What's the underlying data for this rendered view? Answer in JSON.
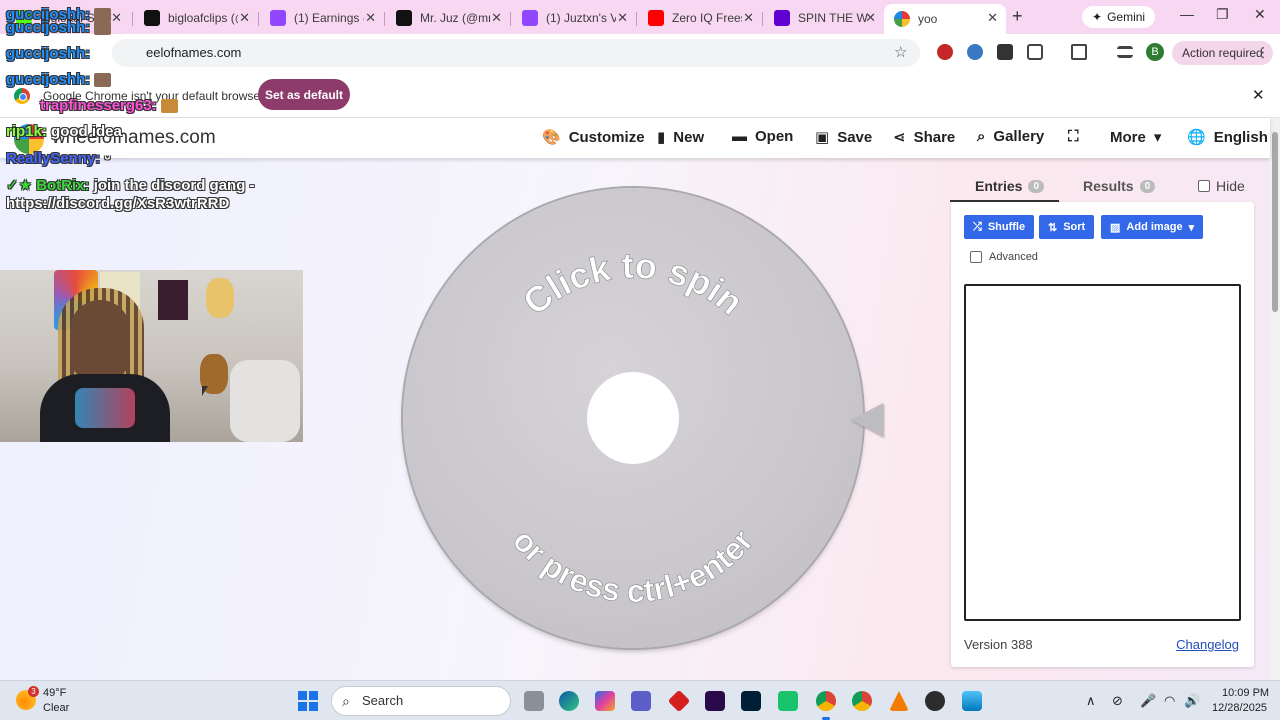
{
  "browser": {
    "tabs": [
      {
        "title": "Bigloaaf Strea",
        "color": "#53fc18"
      },
      {
        "title": "bigloafclips (@",
        "color": "#111111"
      },
      {
        "title": "(1) Earnings -",
        "color": "#9146ff"
      },
      {
        "title": "Mr. Juz (@mr.j",
        "color": "#111111"
      },
      {
        "title": "(1) Juztxn's Vid",
        "color": "#9146ff"
      },
      {
        "title": "Zero IQ Freest",
        "color": "#ff0000"
      },
      {
        "title": "SPIN THE WHE",
        "color": "#6001d2"
      },
      {
        "title": "yoo",
        "color": "#4285f4"
      }
    ],
    "gemini_label": "Gemini",
    "url": "eelofnames.com",
    "action_required": "Action required",
    "profile_initial": "B"
  },
  "infobar": {
    "message": "Google Chrome isn't your default browser",
    "button": "Set as default"
  },
  "site": {
    "name": "wheelofnames.com",
    "nav": [
      {
        "label": "Customize",
        "icon": "palette-icon"
      },
      {
        "label": "New",
        "icon": "file-icon"
      },
      {
        "label": "Open",
        "icon": "folder-icon"
      },
      {
        "label": "Save",
        "icon": "save-icon"
      },
      {
        "label": "Share",
        "icon": "share-icon"
      },
      {
        "label": "Gallery",
        "icon": "search-icon"
      },
      {
        "label": "More",
        "icon": "chevron-down-icon"
      },
      {
        "label": "English",
        "icon": "globe-icon"
      }
    ]
  },
  "wheel": {
    "top_text": "Click to spin",
    "bottom_text": "or press ctrl+enter"
  },
  "panel": {
    "entries_label": "Entries",
    "entries_count": "0",
    "results_label": "Results",
    "results_count": "0",
    "hide_label": "Hide",
    "shuffle_label": "Shuffle",
    "sort_label": "Sort",
    "add_image_label": "Add image",
    "advanced_label": "Advanced",
    "version": "Version 388",
    "changelog": "Changelog",
    "accent_color": "#3369e8"
  },
  "overlay": {
    "chat": [
      {
        "user": "guccijoshh:",
        "message": ""
      },
      {
        "user": "guccijoshh:",
        "message": ""
      },
      {
        "user": "guccijoshh:",
        "message": ""
      },
      {
        "user": "guccijoshh:",
        "message": ""
      },
      {
        "user": "trapfinesserg63:",
        "message": ""
      },
      {
        "user": "rip1k:",
        "message": "good idea"
      },
      {
        "user": "ReallySenny:",
        "message": ""
      },
      {
        "user": "BotRix:",
        "message": "join the discord gang -"
      },
      {
        "user": "",
        "message": "https://discord.gg/XsR3wtrRRD"
      }
    ],
    "title_text": "yoo"
  },
  "taskbar": {
    "temperature": "49°F",
    "condition": "Clear",
    "weather_badge": "3",
    "search_placeholder": "Search",
    "time": "10:09 PM",
    "date": "12/28/2025"
  }
}
